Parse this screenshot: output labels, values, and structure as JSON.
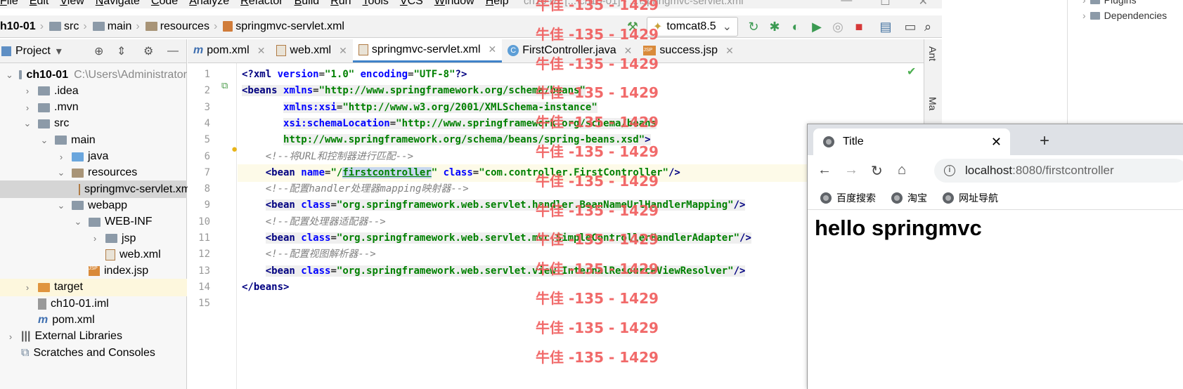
{
  "menu": [
    "File",
    "Edit",
    "View",
    "Navigate",
    "Code",
    "Analyze",
    "Refactor",
    "Build",
    "Run",
    "Tools",
    "VCS",
    "Window",
    "Help"
  ],
  "window_title": "ch10-01 [...\\ch10-01] - ...\\springmvc-servlet.xml",
  "breadcrumbs": [
    "h10-01",
    "src",
    "main",
    "resources",
    "springmvc-servlet.xml"
  ],
  "run_config": "tomcat8.5",
  "project_panel": {
    "title": "Project"
  },
  "tree": [
    {
      "label": "ch10-01",
      "extra": "C:\\Users\\Administrator",
      "indent": 0,
      "chev": "open",
      "icon": "folder"
    },
    {
      "label": ".idea",
      "indent": 1,
      "chev": "closed",
      "icon": "folder"
    },
    {
      "label": ".mvn",
      "indent": 1,
      "chev": "closed",
      "icon": "folder"
    },
    {
      "label": "src",
      "indent": 1,
      "chev": "open",
      "icon": "folder"
    },
    {
      "label": "main",
      "indent": 2,
      "chev": "open",
      "icon": "folder"
    },
    {
      "label": "java",
      "indent": 3,
      "chev": "closed",
      "icon": "folder-blue"
    },
    {
      "label": "resources",
      "indent": 3,
      "chev": "open",
      "icon": "folder-res"
    },
    {
      "label": "springmvc-servlet.xml",
      "indent": 4,
      "chev": "none",
      "icon": "xml"
    },
    {
      "label": "webapp",
      "indent": 3,
      "chev": "open",
      "icon": "folder-web"
    },
    {
      "label": "WEB-INF",
      "indent": 4,
      "chev": "open",
      "icon": "folder"
    },
    {
      "label": "jsp",
      "indent": 5,
      "chev": "closed",
      "icon": "folder"
    },
    {
      "label": "web.xml",
      "indent": 5,
      "chev": "none",
      "icon": "xml"
    },
    {
      "label": "index.jsp",
      "indent": 4,
      "chev": "none",
      "icon": "jsp"
    },
    {
      "label": "target",
      "indent": 1,
      "chev": "closed",
      "icon": "folder-orange"
    },
    {
      "label": "ch10-01.iml",
      "indent": 1,
      "chev": "none",
      "icon": "iml"
    },
    {
      "label": "pom.xml",
      "indent": 1,
      "chev": "none",
      "icon": "m"
    },
    {
      "label": "External Libraries",
      "indent": 0,
      "chev": "closed",
      "icon": "lib"
    },
    {
      "label": "Scratches and Consoles",
      "indent": 0,
      "chev": "none",
      "icon": "scratch"
    }
  ],
  "tabs": [
    {
      "label": "pom.xml",
      "icon": "m"
    },
    {
      "label": "web.xml",
      "icon": "xml"
    },
    {
      "label": "springmvc-servlet.xml",
      "icon": "xml",
      "active": true
    },
    {
      "label": "FirstController.java",
      "icon": "c"
    },
    {
      "label": "success.jsp",
      "icon": "jsp"
    }
  ],
  "code_lines": [
    [
      [
        "tag",
        "<?xml "
      ],
      [
        "attr",
        "version"
      ],
      [
        "",
        "="
      ],
      [
        "val",
        "\"1.0\""
      ],
      [
        "",
        " "
      ],
      [
        "attr",
        "encoding"
      ],
      [
        "",
        "="
      ],
      [
        "val",
        "\"UTF-8\""
      ],
      [
        "tag",
        "?>"
      ]
    ],
    [
      [
        "tag",
        "<beans "
      ],
      [
        "attr",
        "xmlns"
      ],
      [
        "",
        "="
      ],
      [
        "val",
        "\"http://www.springframework.org/schema/beans\""
      ]
    ],
    [
      [
        "",
        "       "
      ],
      [
        "attr",
        "xmlns:xsi"
      ],
      [
        "",
        "="
      ],
      [
        "val",
        "\"http://www.w3.org/2001/XMLSchema-instance\""
      ]
    ],
    [
      [
        "",
        "       "
      ],
      [
        "attr",
        "xsi:schemaLocation"
      ],
      [
        "",
        "="
      ],
      [
        "val",
        "\"http://www.springframework.org/schema/beans"
      ]
    ],
    [
      [
        "",
        "       "
      ],
      [
        "val",
        "http://www.springframework.org/schema/beans/spring-beans.xsd\""
      ],
      [
        "tag",
        ">"
      ]
    ],
    [
      [
        "",
        "    "
      ],
      [
        "cmt",
        "<!--将URL和控制器进行匹配-->"
      ]
    ],
    [
      [
        "",
        "    "
      ],
      [
        "tag",
        "<bean "
      ],
      [
        "attr",
        "name"
      ],
      [
        "",
        "="
      ],
      [
        "val",
        "\"/"
      ],
      [
        "sel",
        "firstcontroller"
      ],
      [
        "val",
        "\""
      ],
      [
        "",
        " "
      ],
      [
        "attr",
        "class"
      ],
      [
        "",
        "="
      ],
      [
        "val",
        "\"com.controller.FirstController\""
      ],
      [
        "tag",
        "/>"
      ]
    ],
    [
      [
        "",
        "    "
      ],
      [
        "cmt",
        "<!--配置handler处理器mapping映射器-->"
      ]
    ],
    [
      [
        "",
        "    "
      ],
      [
        "tag",
        "<bean "
      ],
      [
        "attr",
        "class"
      ],
      [
        "",
        "="
      ],
      [
        "val",
        "\"org.springframework.web.servlet.handler.BeanNameUrlHandlerMapping\""
      ],
      [
        "tag",
        "/>"
      ]
    ],
    [
      [
        "",
        "    "
      ],
      [
        "cmt",
        "<!--配置处理器适配器-->"
      ]
    ],
    [
      [
        "",
        "    "
      ],
      [
        "tag",
        "<bean "
      ],
      [
        "attr",
        "class"
      ],
      [
        "",
        "="
      ],
      [
        "val",
        "\"org.springframework.web.servlet.mvc.SimpleControllerHandlerAdapter\""
      ],
      [
        "tag",
        "/>"
      ]
    ],
    [
      [
        "",
        "    "
      ],
      [
        "cmt",
        "<!--配置视图解析器-->"
      ]
    ],
    [
      [
        "",
        "    "
      ],
      [
        "tag",
        "<bean "
      ],
      [
        "attr",
        "class"
      ],
      [
        "",
        "="
      ],
      [
        "val",
        "\"org.springframework.web.servlet.view.InternalResourceViewResolver\""
      ],
      [
        "tag",
        "/>"
      ]
    ],
    [
      [
        "tag",
        "</beans>"
      ]
    ],
    []
  ],
  "watermark": "牛佳 -135 - 1429",
  "right_side_labels": [
    "Ant",
    "Ma"
  ],
  "far_right": [
    "Plugins",
    "Dependencies"
  ],
  "browser": {
    "tab_title": "Title",
    "url_host": "localhost",
    "url_rest": ":8080/firstcontroller",
    "bookmarks": [
      "百度搜索",
      "淘宝",
      "网址导航"
    ],
    "content": "hello springmvc"
  }
}
